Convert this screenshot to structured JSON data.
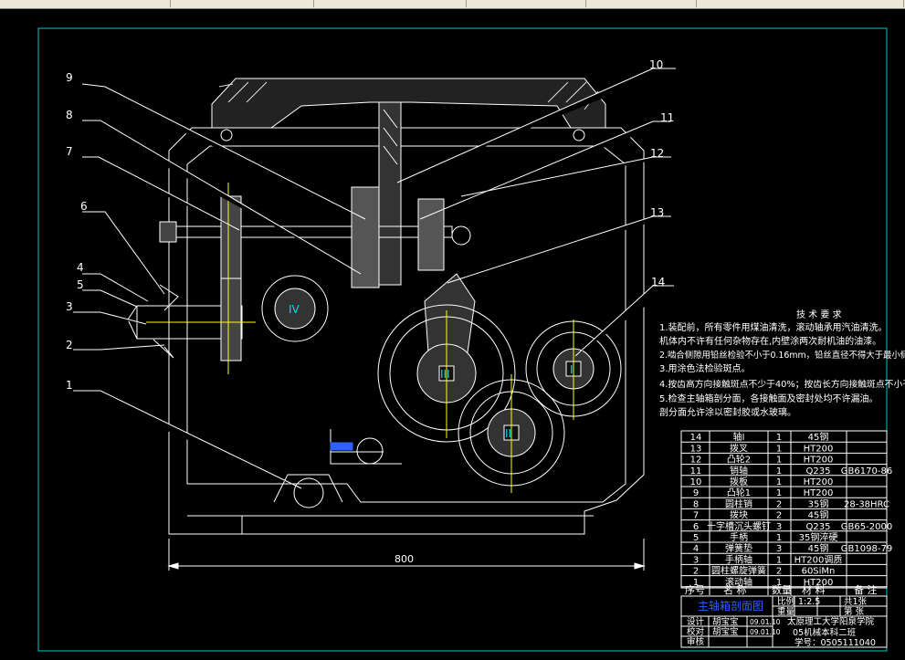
{
  "colors": {
    "background": "#000000",
    "frame": "#00c8c8",
    "lines": "#ffffff",
    "yellow": "#ffff00",
    "blue": "#3060ff",
    "cyan_text": "#00e0e0"
  },
  "callouts": [
    "1",
    "2",
    "3",
    "4",
    "5",
    "6",
    "7",
    "8",
    "9",
    "10",
    "11",
    "12",
    "13",
    "14"
  ],
  "shaft_labels": {
    "iv": "IV",
    "iii": "III",
    "ii": "II",
    "i": "I"
  },
  "dimension": "800",
  "tech_req": {
    "title": "技 术 要 求",
    "lines": [
      "1.装配前，所有零件用煤油清洗，滚动轴承用汽油清洗。",
      "机体内不许有任何杂物存在,内壁涂两次耐机油的油漆。",
      "2.啮合侧隙用铅丝检验不小于0.16mm，铅丝直径不得大于最小侧隙4倍。",
      "3.用涂色法检验斑点。",
      "4.按齿高方向接触斑点不少于40%；按齿长方向接触斑点不小于50%；",
      "5.检查主轴箱剖分面，各接触面及密封处均不许漏油。",
      "剖分面允许涂以密封胶或水玻璃。"
    ]
  },
  "parts": [
    {
      "no": "14",
      "name": "轴Ⅰ",
      "qty": "1",
      "material": "45钢",
      "note": ""
    },
    {
      "no": "13",
      "name": "拨叉",
      "qty": "1",
      "material": "HT200",
      "note": ""
    },
    {
      "no": "12",
      "name": "凸轮2",
      "qty": "1",
      "material": "HT200",
      "note": ""
    },
    {
      "no": "11",
      "name": "销轴",
      "qty": "1",
      "material": "Q235",
      "note": "GB6170-86"
    },
    {
      "no": "10",
      "name": "拨板",
      "qty": "1",
      "material": "HT200",
      "note": ""
    },
    {
      "no": "9",
      "name": "凸轮1",
      "qty": "1",
      "material": "HT200",
      "note": ""
    },
    {
      "no": "8",
      "name": "圆柱销",
      "qty": "2",
      "material": "35钢",
      "note": "28-38HRC"
    },
    {
      "no": "7",
      "name": "拨块",
      "qty": "2",
      "material": "45钢",
      "note": ""
    },
    {
      "no": "6",
      "name": "十字槽沉头螺钉",
      "qty": "3",
      "material": "Q235",
      "note": "GB65-2000"
    },
    {
      "no": "5",
      "name": "手柄",
      "qty": "1",
      "material": "35钢淬硬",
      "note": ""
    },
    {
      "no": "4",
      "name": "弹簧垫",
      "qty": "3",
      "material": "45钢",
      "note": "GB1098-79"
    },
    {
      "no": "3",
      "name": "手柄轴",
      "qty": "1",
      "material": "HT200调质",
      "note": ""
    },
    {
      "no": "2",
      "name": "圆柱螺旋弹簧",
      "qty": "2",
      "material": "60SiMn",
      "note": ""
    },
    {
      "no": "1",
      "name": "滚动轴",
      "qty": "1",
      "material": "HT200",
      "note": ""
    }
  ],
  "parts_header": {
    "no": "序号",
    "name": "名 称",
    "qty": "数量",
    "material": "材 料",
    "note": "备 注"
  },
  "title_block": {
    "drawing_name": "主轴箱剖面图",
    "scale_label": "比例",
    "scale_value": "1:2.5",
    "weight_label": "重量",
    "sheet_label": "共1张",
    "sheet_no": "第 张",
    "school": "太原理工大学阳泉学院",
    "course": "05机械本科二班",
    "student_id": "学号：0505111040",
    "design_label": "设计",
    "check_label": "校对",
    "review_label": "审核",
    "name1": "胡宝宝",
    "name2": "胡宝宝",
    "date1": "09.01.10",
    "date2": "09.01.10"
  }
}
